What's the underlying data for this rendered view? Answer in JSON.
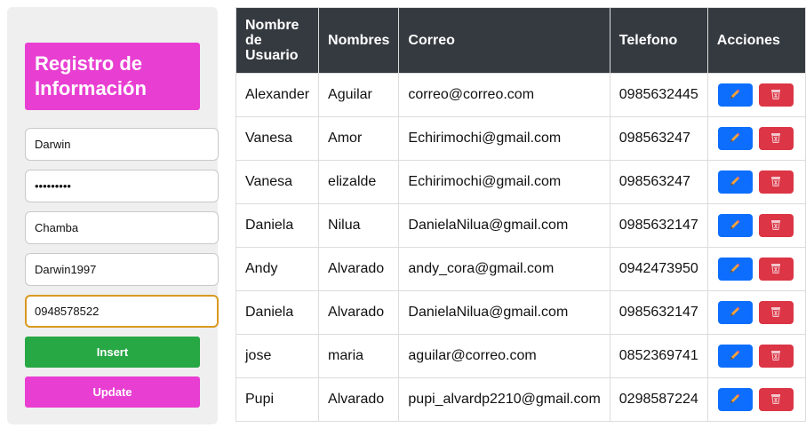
{
  "form": {
    "title": "Registro de Información",
    "fields": [
      "Darwin",
      "•••••••••",
      "Chamba",
      "Darwin1997",
      "0948578522"
    ],
    "insert_label": "Insert",
    "update_label": "Update"
  },
  "table": {
    "headers": [
      "Nombre de Usuario",
      "Nombres",
      "Correo",
      "Telefono",
      "Acciones"
    ],
    "rows": [
      [
        "Alexander",
        "Aguilar",
        "correo@correo.com",
        "0985632445"
      ],
      [
        "Vanesa",
        "Amor",
        "Echirimochi@gmail.com",
        "098563247"
      ],
      [
        "Vanesa",
        "elizalde",
        "Echirimochi@gmail.com",
        "098563247"
      ],
      [
        "Daniela",
        "Nilua",
        "DanielaNilua@gmail.com",
        "0985632147"
      ],
      [
        "Andy",
        "Alvarado",
        "andy_cora@gmail.com",
        "0942473950"
      ],
      [
        "Daniela",
        "Alvarado",
        "DanielaNilua@gmail.com",
        "0985632147"
      ],
      [
        "jose",
        "maria",
        "aguilar@correo.com",
        "0852369741"
      ],
      [
        "Pupi",
        "Alvarado",
        "pupi_alvardp2210@gmail.com",
        "0298587224"
      ]
    ]
  },
  "icons": {
    "edit": "pencil-icon",
    "delete": "trash-icon"
  },
  "colors": {
    "title_bg": "#e83fd2",
    "insert": "#28a745",
    "update": "#e83fd2",
    "header_bg": "#343a40",
    "edit": "#0d6efd",
    "delete": "#dc3545",
    "focus_border": "#d99a20"
  }
}
